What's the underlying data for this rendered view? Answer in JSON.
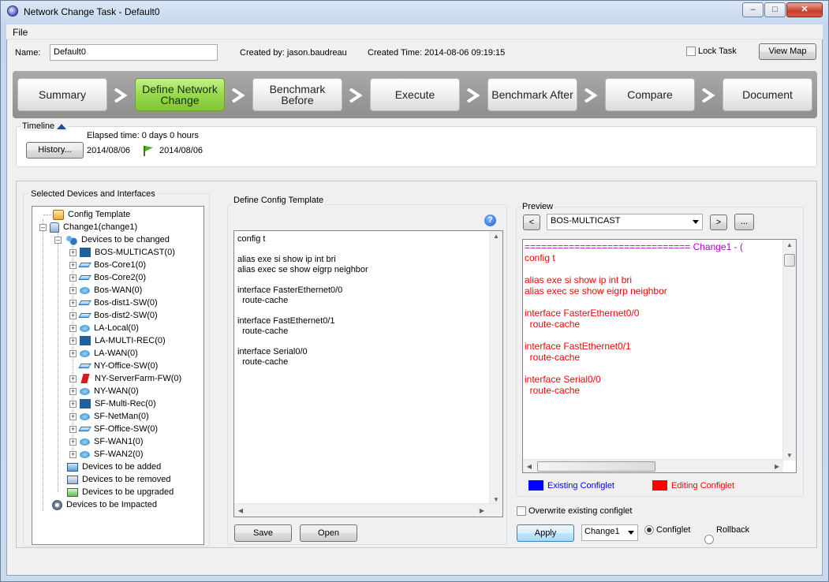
{
  "window": {
    "title": "Network Change Task - Default0",
    "controls": [
      "minimize",
      "maximize",
      "close"
    ]
  },
  "menu": {
    "file": "File"
  },
  "header": {
    "name_label": "Name:",
    "name_value": "Default0",
    "created_by": "Created by: jason.baudreau",
    "created_time": "Created Time: 2014-08-06 09:19:15",
    "lock_task_label": "Lock Task",
    "lock_task_checked": false,
    "view_map_label": "View Map"
  },
  "steps": [
    {
      "label": "Summary",
      "active": false
    },
    {
      "label": "Define Network Change",
      "active": true
    },
    {
      "label": "Benchmark Before",
      "active": false
    },
    {
      "label": "Execute",
      "active": false
    },
    {
      "label": "Benchmark After",
      "active": false
    },
    {
      "label": "Compare",
      "active": false
    },
    {
      "label": "Document",
      "active": false
    }
  ],
  "timeline": {
    "label": "Timeline",
    "elapsed": "Elapsed time: 0 days 0 hours",
    "history_button": "History...",
    "start_date": "2014/08/06",
    "end_date": "2014/08/06"
  },
  "devices_panel": {
    "title": "Selected Devices and Interfaces",
    "tree": {
      "config_template": "Config Template",
      "change": "Change1(change1)",
      "to_be_changed": "Devices to be changed",
      "devices": [
        {
          "label": "BOS-MULTICAST(0)",
          "icon": "multicast-icon"
        },
        {
          "label": "Bos-Core1(0)",
          "icon": "switch-icon"
        },
        {
          "label": "Bos-Core2(0)",
          "icon": "switch-icon"
        },
        {
          "label": "Bos-WAN(0)",
          "icon": "router-icon"
        },
        {
          "label": "Bos-dist1-SW(0)",
          "icon": "switch-icon"
        },
        {
          "label": "Bos-dist2-SW(0)",
          "icon": "switch-icon"
        },
        {
          "label": "LA-Local(0)",
          "icon": "router-icon"
        },
        {
          "label": "LA-MULTI-REC(0)",
          "icon": "multicast-icon"
        },
        {
          "label": "LA-WAN(0)",
          "icon": "router-icon"
        },
        {
          "label": "NY-Office-SW(0)",
          "icon": "switch-icon"
        },
        {
          "label": "NY-ServerFarm-FW(0)",
          "icon": "firewall-icon"
        },
        {
          "label": "NY-WAN(0)",
          "icon": "router-icon"
        },
        {
          "label": "SF-Multi-Rec(0)",
          "icon": "multicast-icon"
        },
        {
          "label": "SF-NetMan(0)",
          "icon": "router-icon"
        },
        {
          "label": "SF-Office-SW(0)",
          "icon": "switch-icon"
        },
        {
          "label": "SF-WAN1(0)",
          "icon": "router-icon"
        },
        {
          "label": "SF-WAN2(0)",
          "icon": "router-icon"
        }
      ],
      "to_be_added": "Devices to be added",
      "to_be_removed": "Devices to be removed",
      "to_be_upgraded": "Devices to be upgraded",
      "to_be_impacted": "Devices to be Impacted"
    }
  },
  "template_panel": {
    "title": "Define Config Template",
    "lines": [
      "config t",
      "",
      "alias exe si show ip int bri",
      "alias exec se show eigrp neighbor",
      "",
      "interface FasterEthernet0/0",
      "  route-cache",
      "",
      "interface FastEthernet0/1",
      "  route-cache",
      "",
      "interface Serial0/0",
      "  route-cache"
    ],
    "save_label": "Save",
    "open_label": "Open"
  },
  "preview_panel": {
    "title": "Preview",
    "prev_label": "<",
    "next_label": ">",
    "more_label": "...",
    "device_selected": "BOS-MULTICAST",
    "header_line": "============================== Change1 - (",
    "lines": [
      "config t",
      "",
      "alias exe si show ip int bri",
      "alias exec se show eigrp neighbor",
      "",
      "interface FasterEthernet0/0",
      "  route-cache",
      "",
      "interface FastEthernet0/1",
      "  route-cache",
      "",
      "interface Serial0/0",
      "  route-cache"
    ],
    "legend_existing": "Existing Configlet",
    "legend_editing": "Editing Configlet",
    "color_existing": "#0000ff",
    "color_editing": "#ff0000",
    "color_header": "#b000c8",
    "overwrite_label": "Overwrite existing configlet",
    "overwrite_checked": false,
    "apply_label": "Apply",
    "change_selected": "Change1",
    "radio_configlet": "Configlet",
    "radio_rollback": "Rollback",
    "radio_selected": "Configlet"
  }
}
